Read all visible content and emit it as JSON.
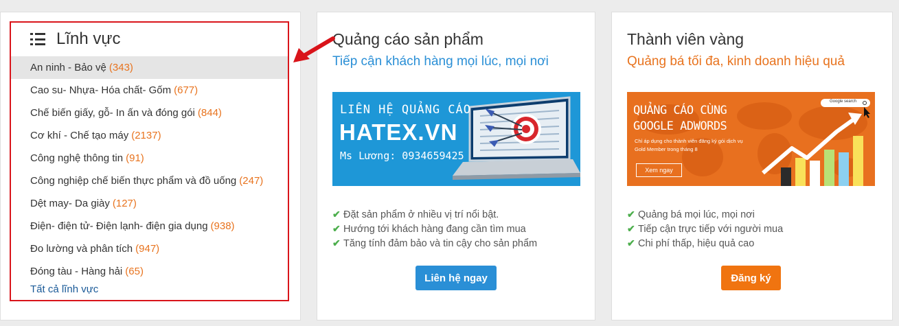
{
  "fields_panel": {
    "title": "Lĩnh vực",
    "items": [
      {
        "label": "An ninh - Bảo vệ",
        "count": "(343)"
      },
      {
        "label": "Cao su- Nhựa- Hóa chất- Gốm",
        "count": "(677)"
      },
      {
        "label": "Chế biến giấy, gỗ- In ấn và đóng gói",
        "count": "(844)"
      },
      {
        "label": "Cơ khí - Chế tạo máy",
        "count": "(2137)"
      },
      {
        "label": "Công nghệ thông tin",
        "count": "(91)"
      },
      {
        "label": "Công nghiệp chế biến thực phẩm và đồ uống",
        "count": "(247)"
      },
      {
        "label": "Dệt may- Da giày",
        "count": "(127)"
      },
      {
        "label": "Điện- điện tử- Điện lạnh- điện gia dụng",
        "count": "(938)"
      },
      {
        "label": "Đo lường và phân tích",
        "count": "(947)"
      },
      {
        "label": "Đóng tàu - Hàng hải",
        "count": "(65)"
      }
    ],
    "all_link": "Tất cả lĩnh vực"
  },
  "ads_card": {
    "title": "Quảng cáo sản phẩm",
    "subtitle": "Tiếp cận khách hàng mọi lúc, mọi nơi",
    "banner": {
      "line1": "LIÊN HỆ QUẢNG CÁO",
      "line2": "HATEX.VN",
      "line3": "Ms Lương: 0934659425"
    },
    "benefits": [
      "Đặt sản phẩm ở nhiều vị trí nổi bật.",
      "Hướng tới khách hàng đang cần tìm mua",
      "Tăng tính đảm bảo và tin cậy cho sản phẩm"
    ],
    "button": "Liên hệ ngay"
  },
  "gold_card": {
    "title": "Thành viên vàng",
    "subtitle": "Quảng bá tối đa, kinh doanh hiệu quả",
    "banner": {
      "line1": "QUẢNG CÁO CÙNG",
      "line2": "GOOGLE ADWORDS",
      "line3": "Chỉ áp dụng cho thành viên đăng ký gói dịch vụ",
      "line4": "Gold Member trong tháng 8",
      "button": "Xem ngay",
      "search": "Google search"
    },
    "benefits": [
      "Quảng bá mọi lúc, mọi nơi",
      "Tiếp cận trực tiếp với người mua",
      "Chi phí thấp, hiệu quả cao"
    ],
    "button": "Đăng ký"
  },
  "colors": {
    "accent_blue": "#2a8fd6",
    "accent_orange": "#e8731e",
    "highlight_red": "#d9141a",
    "check_green": "#4cae4c"
  }
}
